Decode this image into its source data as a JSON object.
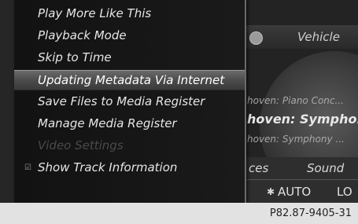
{
  "menu": {
    "items": [
      {
        "label": "Play More Like This",
        "state": "normal"
      },
      {
        "label": "Playback Mode",
        "state": "normal"
      },
      {
        "label": "Skip to Time",
        "state": "normal"
      },
      {
        "label": "Updating Metadata Via Internet",
        "state": "selected"
      },
      {
        "label": "Save Files to Media Register",
        "state": "normal"
      },
      {
        "label": "Manage Media Register",
        "state": "normal"
      },
      {
        "label": "Video Settings",
        "state": "disabled"
      },
      {
        "label": "Show Track Information",
        "state": "checked"
      }
    ]
  },
  "background": {
    "vehicle_label": "Vehicle",
    "tracks": [
      "hoven: Piano Conc...",
      "hoven: Sympho...",
      "hoven: Symphony ..."
    ],
    "services_label": "ces",
    "sound_label": "Sound",
    "climate_auto": "AUTO",
    "climate_level": "LO",
    "fan_icon": "fan-icon",
    "globe_icon": "globe-icon"
  },
  "reference_code": "P82.87-9405-31",
  "colors": {
    "selected_highlight": "#5a5a5a",
    "disabled_text": "#4a4a4a",
    "menu_text": "#e6e6e6"
  }
}
